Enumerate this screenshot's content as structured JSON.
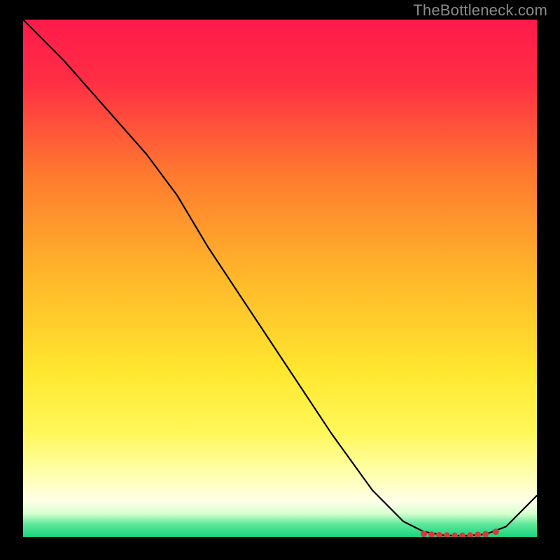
{
  "attribution": "TheBottleneck.com",
  "chart_data": {
    "type": "line",
    "title": "",
    "xlabel": "",
    "ylabel": "",
    "xlim": [
      0,
      100
    ],
    "ylim": [
      0,
      100
    ],
    "background_gradient": {
      "stops": [
        {
          "offset": 0.0,
          "color": "#ff1a4b"
        },
        {
          "offset": 0.12,
          "color": "#ff2e44"
        },
        {
          "offset": 0.3,
          "color": "#ff7a2f"
        },
        {
          "offset": 0.5,
          "color": "#ffb82a"
        },
        {
          "offset": 0.68,
          "color": "#ffe72f"
        },
        {
          "offset": 0.8,
          "color": "#fff85a"
        },
        {
          "offset": 0.88,
          "color": "#ffffb0"
        },
        {
          "offset": 0.93,
          "color": "#ffffe8"
        },
        {
          "offset": 0.955,
          "color": "#d8ffd0"
        },
        {
          "offset": 0.975,
          "color": "#5fe89a"
        },
        {
          "offset": 1.0,
          "color": "#17d47e"
        }
      ]
    },
    "series": [
      {
        "name": "curve",
        "stroke": "#000000",
        "stroke_width": 2.2,
        "x": [
          0,
          8,
          16,
          24,
          30,
          36,
          44,
          52,
          60,
          68,
          74,
          78,
          82,
          86,
          90,
          94,
          100
        ],
        "values": [
          100,
          92,
          83,
          74,
          66,
          56,
          44,
          32,
          20,
          9,
          3,
          1,
          0.3,
          0.2,
          0.5,
          2,
          8
        ]
      }
    ],
    "markers": {
      "name": "highlight-points",
      "color": "#d63b3b",
      "radius": 4.5,
      "x": [
        78,
        79.5,
        81,
        82.5,
        84,
        85.5,
        87,
        88.5,
        90,
        92
      ],
      "values": [
        0.6,
        0.45,
        0.35,
        0.3,
        0.25,
        0.25,
        0.3,
        0.4,
        0.55,
        1.0
      ]
    }
  }
}
